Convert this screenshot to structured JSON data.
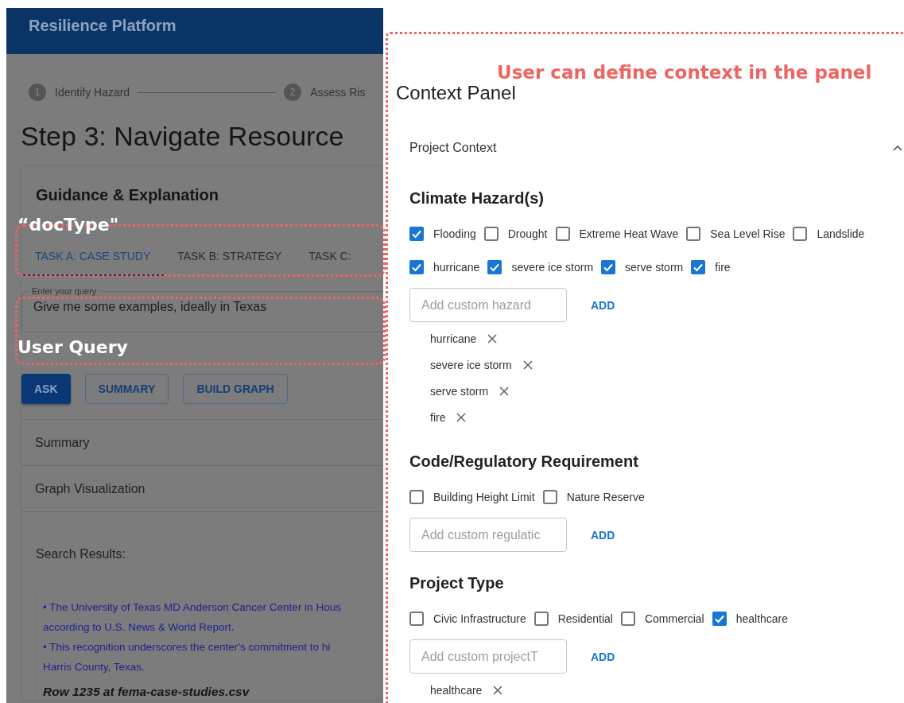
{
  "app": {
    "title": "Resilience Platform",
    "steps": [
      {
        "number": "1",
        "label": "Identify Hazard"
      },
      {
        "number": "2",
        "label": "Assess Ris"
      }
    ],
    "heading": "Step 3: Navigate Resource",
    "guidance": {
      "title": "Guidance & Explanation",
      "tabs": [
        {
          "label": "TASK A: CASE STUDY",
          "selected": true
        },
        {
          "label": "TASK B: STRATEGY",
          "selected": false
        },
        {
          "label": "TASK C:",
          "selected": false
        }
      ]
    },
    "query": {
      "label": "Enter your query",
      "value": "Give me some examples, ideally in Texas"
    },
    "buttons": [
      {
        "label": "ASK",
        "kind": "contained"
      },
      {
        "label": "SUMMARY",
        "kind": "outlined"
      },
      {
        "label": "BUILD GRAPH",
        "kind": "outlined"
      }
    ],
    "sections": [
      "Summary",
      "Graph Visualization"
    ],
    "results": {
      "title": "Search Results:",
      "lines": [
        "• The University of Texas MD Anderson Cancer Center in Hous",
        "according to U.S. News & World Report.",
        "• This recognition underscores the center's commitment to hi",
        "Harris County, Texas."
      ],
      "source": "Row 1235 at fema-case-studies.csv"
    }
  },
  "context_panel": {
    "title": "Context Panel",
    "section": {
      "title": "Project Context",
      "expanded": true
    },
    "groups": [
      {
        "title": "Climate Hazard(s)",
        "option_rows": [
          [
            {
              "label": "Flooding",
              "checked": true
            },
            {
              "label": "Drought",
              "checked": false
            },
            {
              "label": "Extreme Heat Wave",
              "checked": false
            },
            {
              "label": "Sea Level Rise",
              "checked": false
            },
            {
              "label": "Landslide",
              "checked": false
            }
          ],
          [
            {
              "label": "hurricane",
              "checked": true
            },
            {
              "label": "severe ice storm",
              "checked": true
            },
            {
              "label": "serve storm",
              "checked": true
            },
            {
              "label": "fire",
              "checked": true
            }
          ]
        ],
        "placeholder": "Add custom hazard",
        "add_label": "ADD",
        "chips": [
          "hurricane",
          "severe ice storm",
          "serve storm",
          "fire"
        ]
      },
      {
        "title": "Code/Regulatory Requirement",
        "option_rows": [
          [
            {
              "label": "Building Height Limit",
              "checked": false
            },
            {
              "label": "Nature Reserve",
              "checked": false
            }
          ]
        ],
        "placeholder": "Add custom regulatic",
        "add_label": "ADD"
      },
      {
        "title": "Project Type",
        "option_rows": [
          [
            {
              "label": "Civic Infrastructure",
              "checked": false
            },
            {
              "label": "Residential",
              "checked": false
            },
            {
              "label": "Commercial",
              "checked": false
            },
            {
              "label": "healthcare",
              "checked": true
            }
          ]
        ],
        "placeholder": "Add custom projectT",
        "add_label": "ADD",
        "chips": [
          "healthcare"
        ]
      }
    ]
  },
  "annotations": [
    {
      "kind": "tabs",
      "label": "“docType\""
    },
    {
      "kind": "query",
      "label": "User Query"
    },
    {
      "kind": "panel",
      "label": "User can define context in the panel"
    }
  ]
}
